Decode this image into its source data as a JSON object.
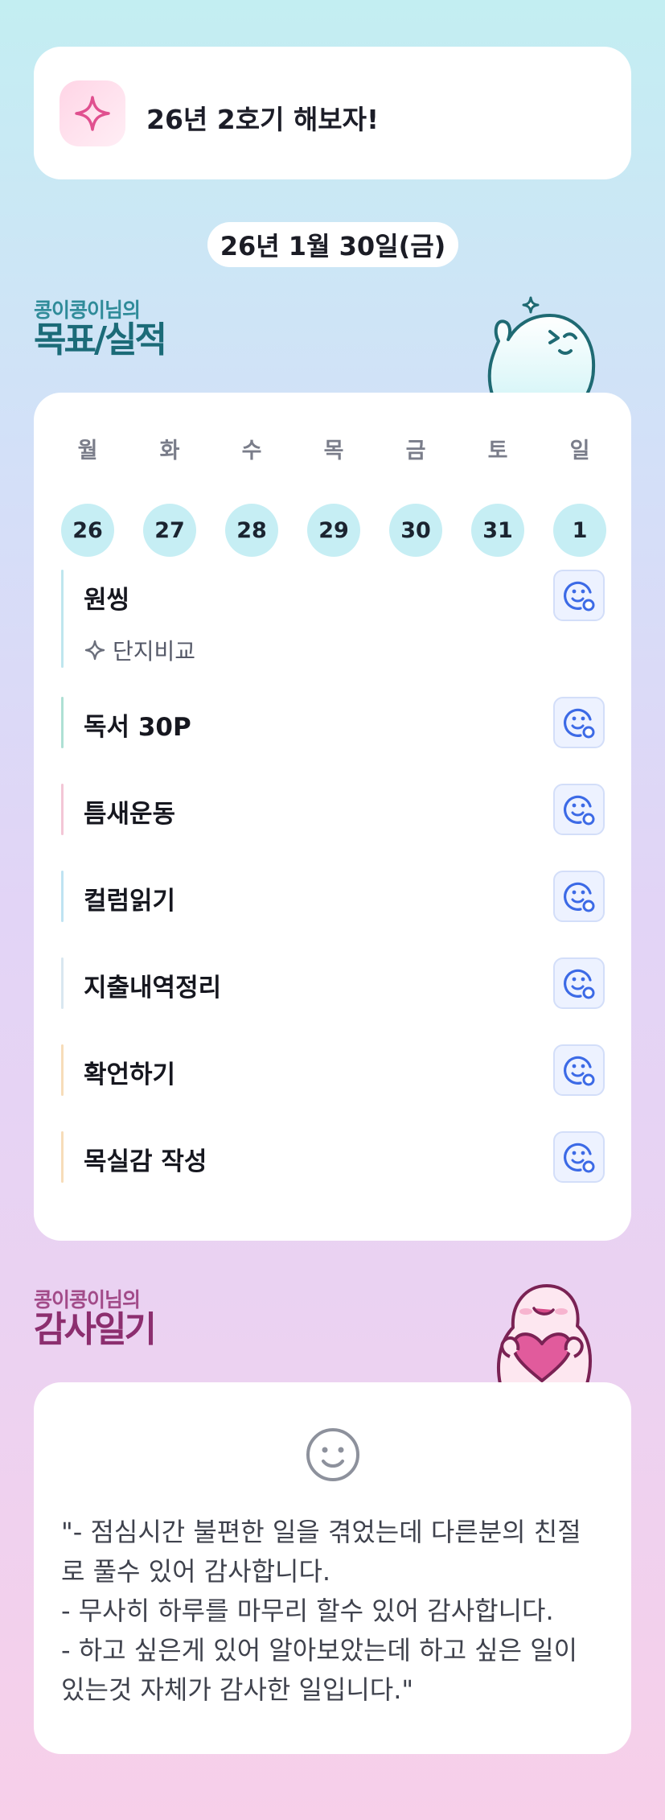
{
  "goal": {
    "text": "26년 2호기 해보자!",
    "icon": "sparkle-icon"
  },
  "date": "26년 1월 30일(금)",
  "goals_section": {
    "owner": "콩이콩이님의",
    "title": "목표/실적"
  },
  "week": [
    {
      "day": "월",
      "date": "26"
    },
    {
      "day": "화",
      "date": "27"
    },
    {
      "day": "수",
      "date": "28"
    },
    {
      "day": "목",
      "date": "29"
    },
    {
      "day": "금",
      "date": "30"
    },
    {
      "day": "토",
      "date": "31"
    },
    {
      "day": "일",
      "date": "1"
    }
  ],
  "goals": [
    {
      "title": "원씽",
      "sub": "단지비교",
      "color": "#bfe6ee"
    },
    {
      "title": "독서 30P",
      "color": "#aee0d4"
    },
    {
      "title": "틈새운동",
      "color": "#f3c6d6"
    },
    {
      "title": "컬럼읽기",
      "color": "#bfe3f2"
    },
    {
      "title": "지출내역정리",
      "color": "#d9e7f0"
    },
    {
      "title": "확언하기",
      "color": "#f7dcb9"
    },
    {
      "title": "목실감 작성",
      "color": "#f7dcb9"
    }
  ],
  "diary_section": {
    "owner": "콩이콩이님의",
    "title": "감사일기"
  },
  "diary": {
    "lines": [
      "\"- 점심시간 불편한 일을 겪었는데 다른분의 친절",
      "로 풀수 있어 감사합니다.",
      "- 무사히 하루를 마무리 할수 있어 감사합니다.",
      "- 하고 싶은게 있어 알아보았는데 하고 싶은 일이",
      "있는것 자체가 감사한 일입니다.\""
    ]
  }
}
